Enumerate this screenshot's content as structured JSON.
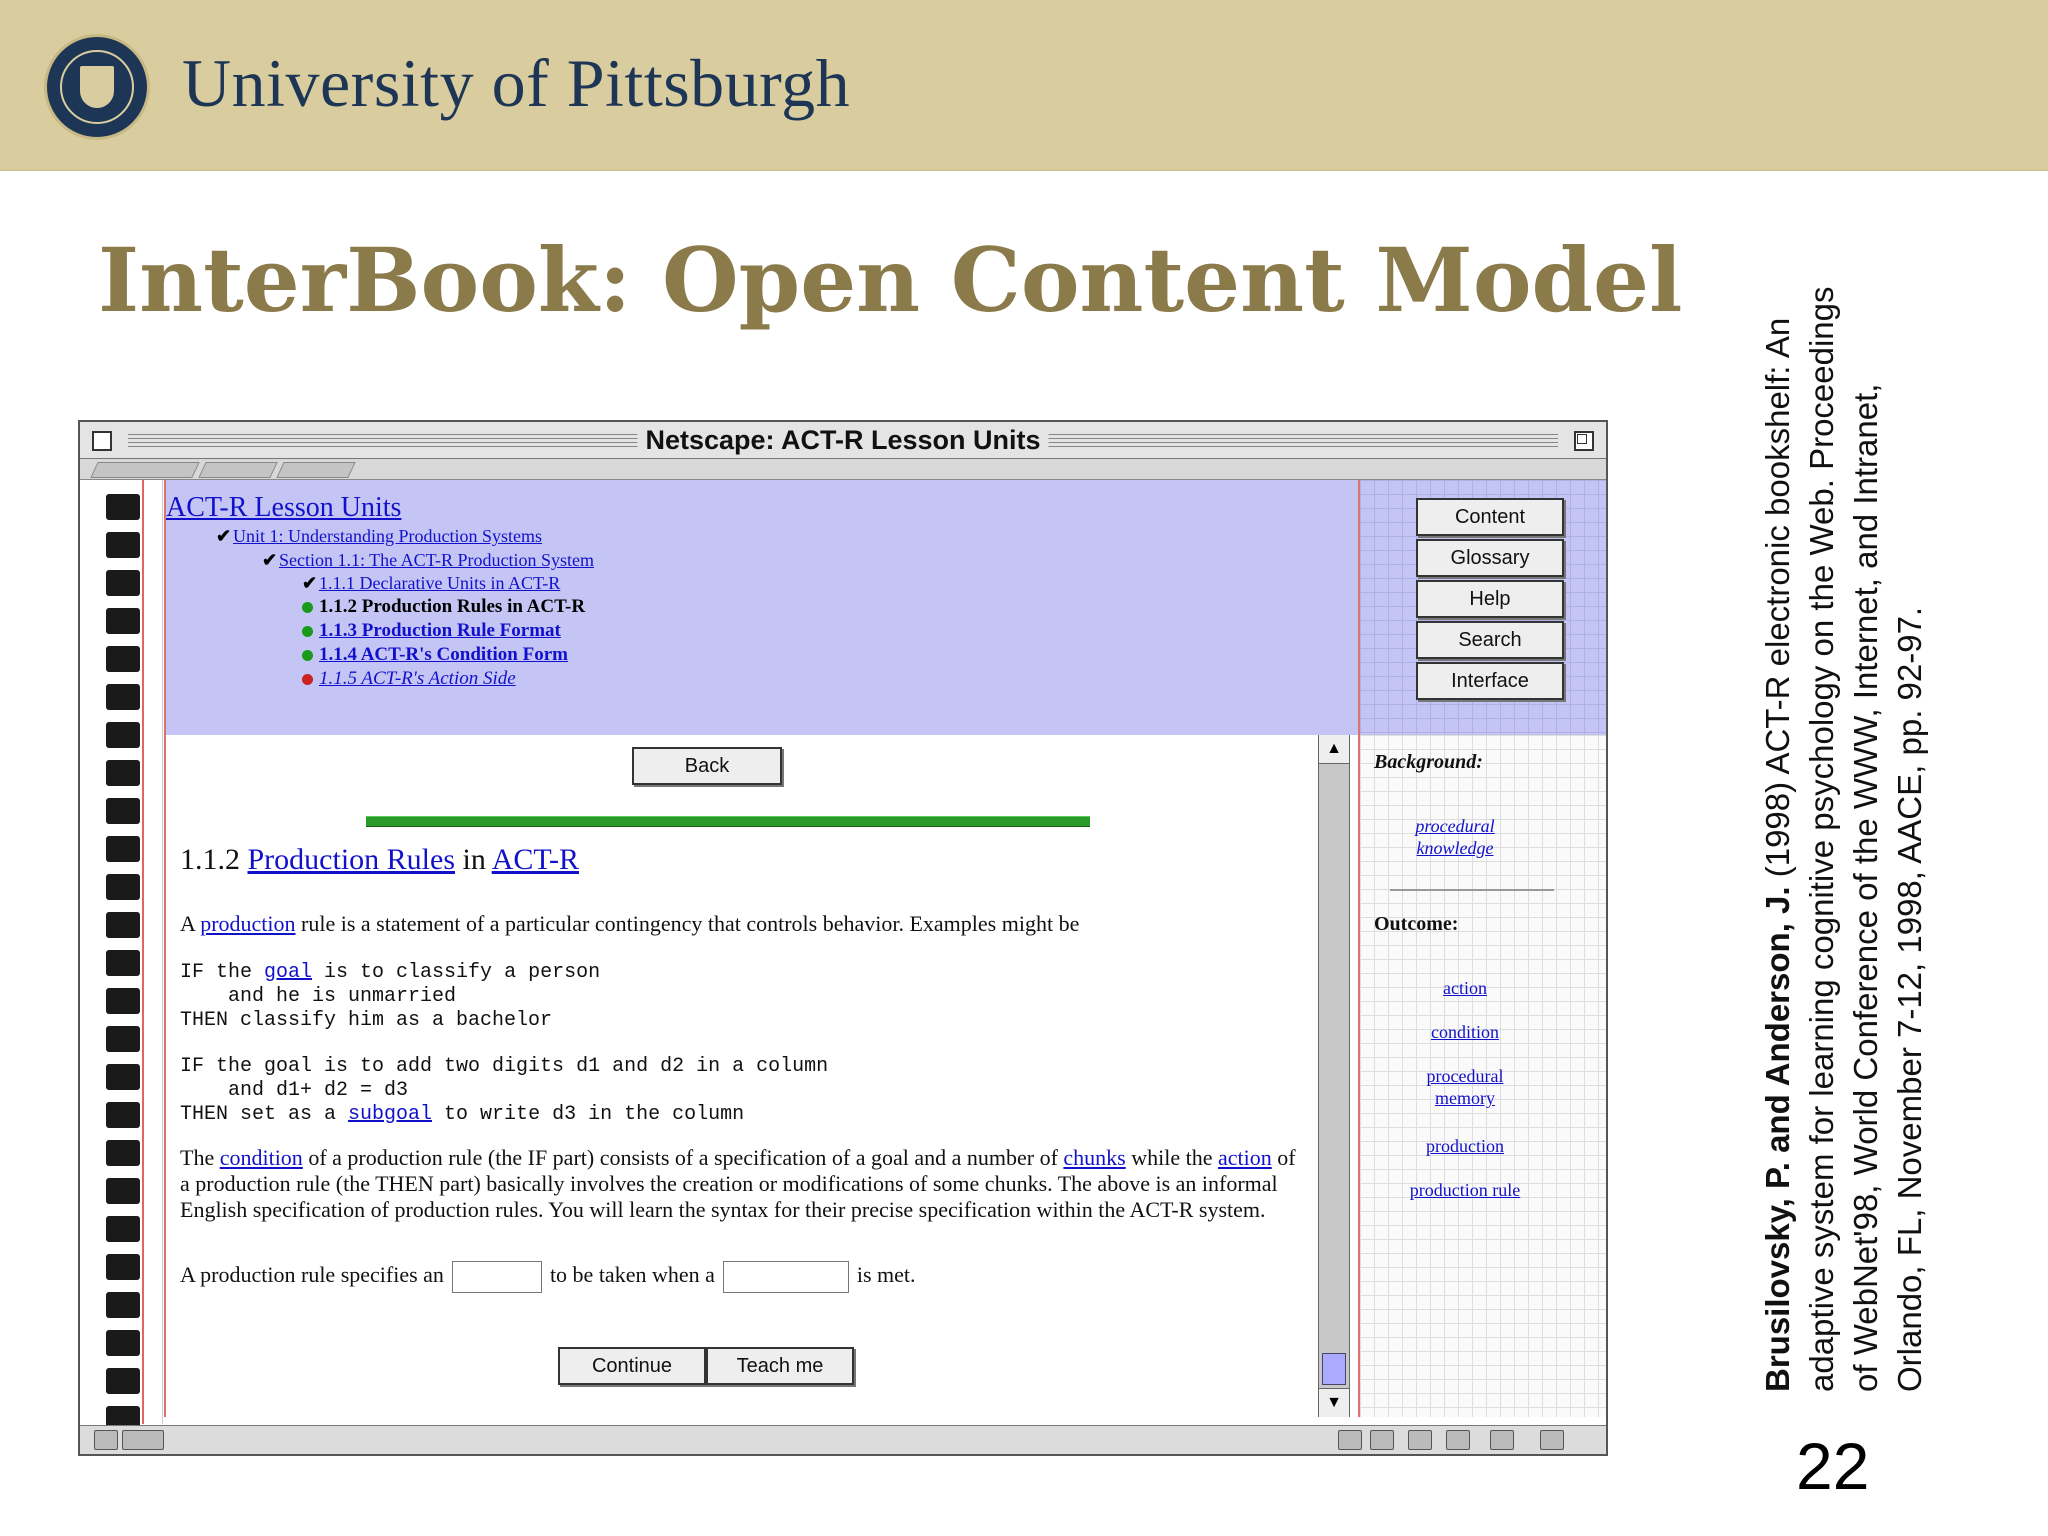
{
  "header": {
    "university_name": "University of Pittsburgh"
  },
  "slide": {
    "title": "InterBook: Open Content Model",
    "citation": {
      "authors": "Brusilovsky, P. and Anderson, J.",
      "text": " (1998) ACT-R electronic bookshelf: An adaptive system for learning cognitive psychology on the Web. Proceedings of WebNet'98, World Conference of the WWW, Internet, and Intranet, Orlando, FL, November 7-12, 1998, AACE, pp. 92-97."
    },
    "page_number": "22"
  },
  "window": {
    "title": "Netscape: ACT-R Lesson Units"
  },
  "toc": {
    "root": "ACT-R Lesson Units",
    "unit": "Unit 1: Understanding Production Systems",
    "section": "Section 1.1: The ACT-R Production System",
    "items": [
      "1.1.1 Declarative Units in ACT-R",
      "1.1.2 Production Rules in ACT-R",
      "1.1.3 Production Rule Format",
      "1.1.4 ACT-R's Condition Form",
      "1.1.5 ACT-R's Action Side"
    ]
  },
  "nav_buttons": [
    "Content",
    "Glossary",
    "Help",
    "Search",
    "Interface"
  ],
  "content": {
    "back_label": "Back",
    "heading_number": "1.1.2",
    "heading_link1": "Production Rules",
    "heading_in": "in",
    "heading_link2": "ACT-R",
    "p1_before": "A",
    "p1_link": "production",
    "p1_after": "rule is a statement of a particular contingency that controls behavior. Examples might be",
    "code1_a": "IF the ",
    "code1_link": "goal",
    "code1_b": " is to classify a person\n    and he is unmarried\nTHEN classify him as a bachelor",
    "code2_a": "IF the goal is to add two digits d1 and d2 in a column\n    and d1+ d2 = d3\nTHEN set as a ",
    "code2_link": "subgoal",
    "code2_b": " to write d3 in the column",
    "p2_t1": "The ",
    "p2_link1": "condition",
    "p2_t2": " of a production rule (the IF part) consists of a specification of a goal and a number of ",
    "p2_link2": "chunks",
    "p2_t3": " while the ",
    "p2_link3": "action",
    "p2_t4": " of a production rule (the THEN part) basically involves the creation or modifications of some chunks. The above is an informal English specification of production rules. You will learn the syntax for their precise specification within the ACT-R system.",
    "q_t1": "A production rule specifies an",
    "q_t2": "to be taken when a",
    "q_t3": "is met.",
    "continue_label": "Continue",
    "teach_label": "Teach me"
  },
  "sidebar": {
    "background_label": "Background:",
    "background_link": "procedural knowledge",
    "outcome_label": "Outcome:",
    "outcome_links": [
      "action",
      "condition",
      "procedural memory",
      "production",
      "production rule"
    ]
  },
  "colors": {
    "banner": "#d9cd9f",
    "title": "#8b7b4b",
    "university": "#1e3656",
    "toc_bg": "#c5c5f5",
    "link": "#1111cc",
    "rule_green": "#2a9a2a"
  }
}
